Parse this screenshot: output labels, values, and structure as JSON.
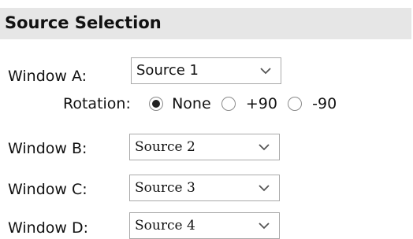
{
  "header": {
    "title": "Source Selection"
  },
  "windows": [
    {
      "label": "Window A:",
      "selected": "Source 1"
    },
    {
      "label": "Window B:",
      "selected": "Source 2"
    },
    {
      "label": "Window C:",
      "selected": "Source 3"
    },
    {
      "label": "Window D:",
      "selected": "Source 4"
    }
  ],
  "rotation": {
    "label": "Rotation:",
    "options": [
      {
        "label": "None",
        "checked": true
      },
      {
        "label": "+90",
        "checked": false
      },
      {
        "label": "-90",
        "checked": false
      }
    ]
  },
  "icons": {
    "dropdown": "chevron-down-icon"
  },
  "colors": {
    "header_bg": "#e6e6e6",
    "border": "#a9a9a9"
  }
}
